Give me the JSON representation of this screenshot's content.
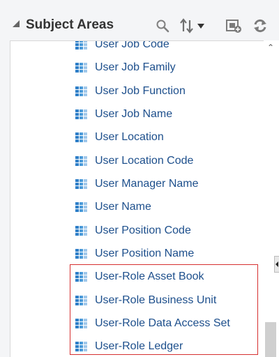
{
  "panel": {
    "title": "Subject Areas",
    "toolbar": {
      "search_icon": "search-icon",
      "sort_icon": "sort-icon",
      "add_icon": "add-to-view-icon",
      "refresh_icon": "refresh-icon"
    }
  },
  "items": [
    {
      "label": "User Job Code"
    },
    {
      "label": "User Job Family"
    },
    {
      "label": "User Job Function"
    },
    {
      "label": "User Job Name"
    },
    {
      "label": "User Location"
    },
    {
      "label": "User Location Code"
    },
    {
      "label": "User Manager Name"
    },
    {
      "label": "User Name"
    },
    {
      "label": "User Position Code"
    },
    {
      "label": "User Position Name"
    },
    {
      "label": "User-Role Asset Book"
    },
    {
      "label": "User-Role Business Unit"
    },
    {
      "label": "User-Role Data Access Set"
    },
    {
      "label": "User-Role Ledger"
    }
  ],
  "colors": {
    "link": "#1d4f8c",
    "highlight_border": "#d63030",
    "icon_blue": "#3b8fd0"
  }
}
